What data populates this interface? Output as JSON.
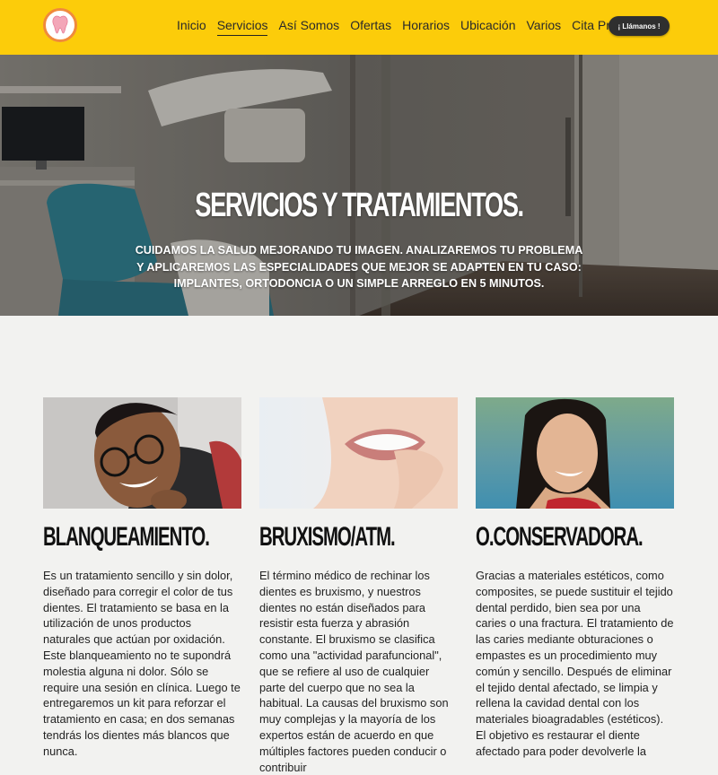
{
  "header": {
    "logo_icon": "tooth-icon",
    "nav": [
      {
        "label": "Inicio",
        "active": false
      },
      {
        "label": "Servicios",
        "active": true
      },
      {
        "label": "Así Somos",
        "active": false
      },
      {
        "label": "Ofertas",
        "active": false
      },
      {
        "label": "Horarios",
        "active": false
      },
      {
        "label": "Ubicación",
        "active": false
      },
      {
        "label": "Varios",
        "active": false
      },
      {
        "label": "Cita Previa",
        "active": false
      }
    ],
    "call_button": "¡ Llámanos !"
  },
  "hero": {
    "title": "SERVICIOS Y TRATAMIENTOS.",
    "subtitle": "Cuidamos la salud mejorando tu imagen. Analizaremos tu problema y aplicaremos las especialidades que mejor se adapten en tu caso: implantes, ortodoncia o un simple arreglo en 5 minutos."
  },
  "cards": [
    {
      "title": "BLANQUEAMIENTO.",
      "text": "Es un tratamiento sencillo y sin dolor, diseñado para corregir el color de tus dientes. El tratamiento se basa en la utilización de unos productos naturales que actúan por oxidación. Este blanqueamiento no te supondrá molestia alguna ni dolor. Sólo se require una sesión en clínica. Luego te entregaremos un kit para reforzar el tratamiento en casa; en dos semanas tendrás los dientes más blancos que nunca."
    },
    {
      "title": "BRUXISMO/ATM.",
      "text": "El término médico de rechinar los dientes es bruxismo, y nuestros dientes no están diseñados para resistir esta fuerza y abrasión constante. El bruxismo se clasifica como una \"actividad parafuncional\", que se refiere al uso de cualquier parte del cuerpo que no sea la habitual. La causas del bruxismo son muy complejas y la mayoría de los expertos están de acuerdo en que múltiples factores pueden conducir o contribuir"
    },
    {
      "title": "O.CONSERVADORA.",
      "text": "Gracias a materiales estéticos, como composites, se puede sustituir el tejido dental perdido, bien sea por una caries o una fractura. El tratamiento de las caries mediante obturaciones o empastes es un procedimiento muy común y sencillo. Después de eliminar el tejido dental afectado, se limpia y rellena la cavidad dental con los materiales bioagradables (estéticos). El objetivo es restaurar el diente afectado para poder devolverle la"
    }
  ],
  "colors": {
    "header_bg": "#fccc0a",
    "button_bg": "#2f2f2f",
    "page_bg": "#f2f2f0"
  }
}
